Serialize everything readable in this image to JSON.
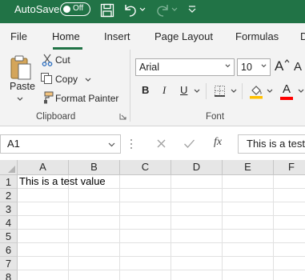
{
  "titlebar": {
    "autosave_label": "AutoSave",
    "autosave_state": "Off",
    "icons": [
      "save-icon",
      "undo-icon",
      "redo-icon",
      "customize-qat-icon"
    ]
  },
  "tabs": [
    "File",
    "Home",
    "Insert",
    "Page Layout",
    "Formulas",
    "D"
  ],
  "active_tab": "Home",
  "clipboard": {
    "paste_label": "Paste",
    "cut_label": "Cut",
    "copy_label": "Copy",
    "format_painter_label": "Format Painter",
    "group_label": "Clipboard"
  },
  "font": {
    "family": "Arial",
    "size": "10",
    "bold": "B",
    "italic": "I",
    "underline": "U",
    "group_label": "Font",
    "grow_label": "A",
    "shrink_label": "A",
    "font_color_label": "A"
  },
  "formula_bar": {
    "name_box": "A1",
    "fx_label": "fx",
    "content": "This is a test value"
  },
  "sheet": {
    "columns": [
      "A",
      "B",
      "C",
      "D",
      "E",
      "F"
    ],
    "rows": [
      "1",
      "2",
      "3",
      "4",
      "5",
      "6",
      "7",
      "8"
    ],
    "cells": {
      "A1": "This is a test value"
    }
  },
  "colors": {
    "accent": "#217346",
    "highlight": "#ffc000",
    "font_color": "#ff0000"
  }
}
